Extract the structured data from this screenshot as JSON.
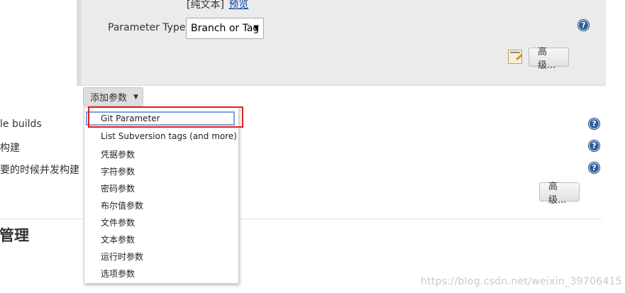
{
  "panel": {
    "plain_text": "[纯文本]",
    "preview_link": "预览",
    "param_type_label": "Parameter Type",
    "param_type_value": "Branch or Tag",
    "advanced_label": "高级..."
  },
  "add_param": {
    "label": "添加参数"
  },
  "left_rows": [
    "le builds",
    "构建",
    "要的时候并发构建"
  ],
  "advanced2_label": "高级...",
  "section_title": "管理",
  "dropdown": {
    "items": [
      "Git Parameter",
      "List Subversion tags (and more)",
      "凭据参数",
      "字符参数",
      "密码参数",
      "布尔值参数",
      "文件参数",
      "文本参数",
      "运行时参数",
      "选项参数"
    ]
  },
  "help_symbol": "?",
  "watermark": "https://blog.csdn.net/weixin_39706415",
  "colors": {
    "highlight": "#e02020",
    "help": "#2d5a9e"
  }
}
